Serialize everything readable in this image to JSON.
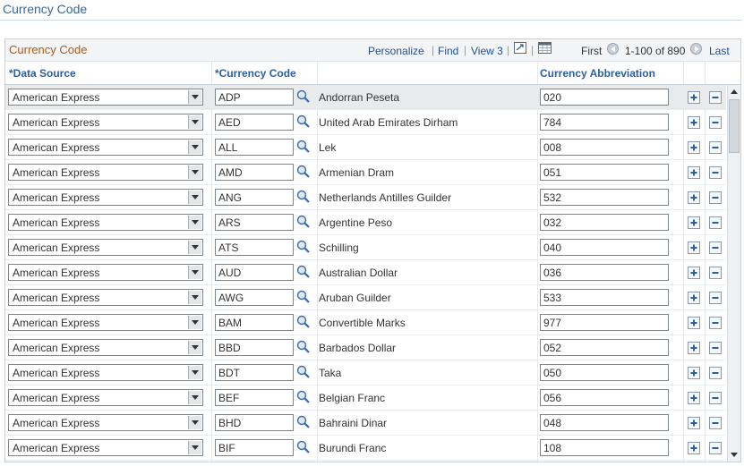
{
  "page": {
    "title": "Currency Code"
  },
  "grid": {
    "title": "Currency Code",
    "toolbar": {
      "personalize": "Personalize",
      "find": "Find",
      "view": "View 3",
      "first": "First",
      "range": "1-100 of 890",
      "last": "Last"
    },
    "columns": {
      "data_source": "*Data Source",
      "currency_code": "*Currency Code",
      "currency_abbreviation": "Currency Abbreviation"
    },
    "rows": [
      {
        "data_source": "American Express",
        "code": "ADP",
        "description": "Andorran Peseta",
        "abbreviation": "020"
      },
      {
        "data_source": "American Express",
        "code": "AED",
        "description": "United Arab Emirates Dirham",
        "abbreviation": "784"
      },
      {
        "data_source": "American Express",
        "code": "ALL",
        "description": "Lek",
        "abbreviation": "008"
      },
      {
        "data_source": "American Express",
        "code": "AMD",
        "description": "Armenian Dram",
        "abbreviation": "051"
      },
      {
        "data_source": "American Express",
        "code": "ANG",
        "description": "Netherlands Antilles Guilder",
        "abbreviation": "532"
      },
      {
        "data_source": "American Express",
        "code": "ARS",
        "description": "Argentine Peso",
        "abbreviation": "032"
      },
      {
        "data_source": "American Express",
        "code": "ATS",
        "description": "Schilling",
        "abbreviation": "040"
      },
      {
        "data_source": "American Express",
        "code": "AUD",
        "description": "Australian Dollar",
        "abbreviation": "036"
      },
      {
        "data_source": "American Express",
        "code": "AWG",
        "description": "Aruban Guilder",
        "abbreviation": "533"
      },
      {
        "data_source": "American Express",
        "code": "BAM",
        "description": "Convertible Marks",
        "abbreviation": "977"
      },
      {
        "data_source": "American Express",
        "code": "BBD",
        "description": "Barbados Dollar",
        "abbreviation": "052"
      },
      {
        "data_source": "American Express",
        "code": "BDT",
        "description": "Taka",
        "abbreviation": "050"
      },
      {
        "data_source": "American Express",
        "code": "BEF",
        "description": "Belgian Franc",
        "abbreviation": "056"
      },
      {
        "data_source": "American Express",
        "code": "BHD",
        "description": "Bahraini Dinar",
        "abbreviation": "048"
      },
      {
        "data_source": "American Express",
        "code": "BIF",
        "description": "Burundi Franc",
        "abbreviation": "108"
      }
    ],
    "icons": {
      "lookup": "magnifier-icon",
      "add": "add-row-icon",
      "delete": "delete-row-icon",
      "download": "download-grid-icon"
    }
  }
}
